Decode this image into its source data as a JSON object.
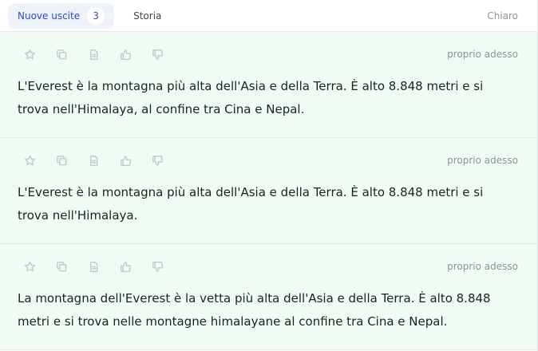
{
  "tabs": {
    "new_outputs_label": "Nuove uscite",
    "new_outputs_count": "3",
    "history_label": "Storia"
  },
  "toolbar": {
    "clear_label": "Chiaro"
  },
  "outputs": [
    {
      "timestamp": "proprio adesso",
      "text": "L'Everest è la montagna più alta dell'Asia e della Terra. È alto 8.848 metri e si trova nell'Himalaya, al confine tra Cina e Nepal."
    },
    {
      "timestamp": "proprio adesso",
      "text": "L'Everest è la montagna più alta dell'Asia e della Terra. È alto 8.848 metri e si trova nell'Himalaya."
    },
    {
      "timestamp": "proprio adesso",
      "text": "La montagna dell'Everest è la vetta più alta dell'Asia e della Terra. È alto 8.848 metri e si trova nelle montagne himalayane al confine tra Cina e Nepal."
    }
  ],
  "icons": [
    "star-icon",
    "copy-icon",
    "document-icon",
    "thumbs-up-icon",
    "thumbs-down-icon"
  ],
  "colors": {
    "accent": "#2a4ad2",
    "card_bg": "#f0fcf3",
    "icon": "#c4cbd3"
  }
}
